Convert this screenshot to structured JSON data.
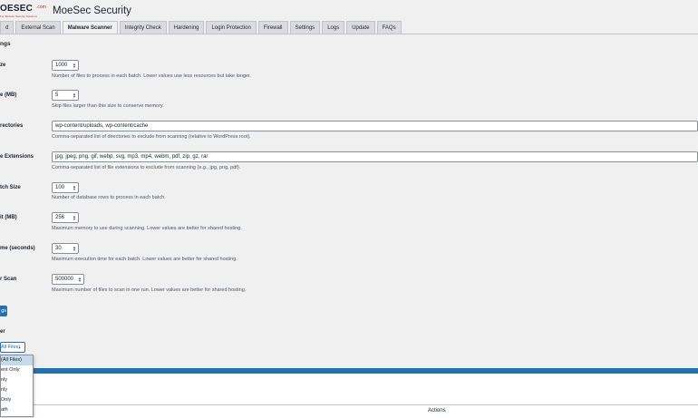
{
  "brand": {
    "logo_text": "OESEC",
    "logo_mark": ".com",
    "logo_tagline": "For Website Security Solutions",
    "app_title": "MoeSec Security"
  },
  "tabs": [
    {
      "label": "d"
    },
    {
      "label": "External Scan"
    },
    {
      "label": "Malware Scanner",
      "active": true
    },
    {
      "label": "Integrity Check"
    },
    {
      "label": "Hardening"
    },
    {
      "label": "Login Protection"
    },
    {
      "label": "Firewall"
    },
    {
      "label": "Settings"
    },
    {
      "label": "Logs"
    },
    {
      "label": "Update"
    },
    {
      "label": "FAQs"
    }
  ],
  "settings": {
    "heading": "ngs",
    "rows": [
      {
        "label": "ze",
        "value": "1000",
        "desc": "Number of files to process in each batch. Lower values use less resources but take longer."
      },
      {
        "label": "e (MB)",
        "value": "5",
        "desc": "Skip files larger than this size to conserve memory."
      },
      {
        "label": "rectories",
        "value": "wp-content/uploads, wp-content/cache",
        "desc": "Comma-separated list of directories to exclude from scanning (relative to WordPress root)."
      },
      {
        "label": "e Extensions",
        "value": "jpg, jpeg, png, gif, webp, svg, mp3, mp4, webm, pdf, zip, gz, rar",
        "desc": "Comma-separated list of file extensions to exclude from scanning (e.g., jpg, png, pdf)."
      },
      {
        "label": "tch Size",
        "value": "100",
        "desc": "Number of database rows to process in each batch."
      },
      {
        "label": "it (MB)",
        "value": "256",
        "desc": "Maximum memory to use during scanning. Lower values are better for shared hosting."
      },
      {
        "label": "me (seconds)",
        "value": "30",
        "desc": "Maximum execution time for each batch. Lower values are better for shared hosting."
      },
      {
        "label": "r Scan",
        "value": "500000",
        "desc": "Maximum number of files to scan in one run. Lower values are better for shared hosting."
      }
    ],
    "save_label": "gs"
  },
  "filter": {
    "label": "er",
    "selected": "All Files)",
    "options": [
      "(All Files)",
      "ent Only",
      "nly",
      "nly",
      "Only",
      "ath"
    ]
  },
  "table": {
    "actions_header": "Actions"
  },
  "colors": {
    "accent": "#2271b1",
    "background": "#f0f0f1",
    "selected_option": "#c5d9ed"
  }
}
